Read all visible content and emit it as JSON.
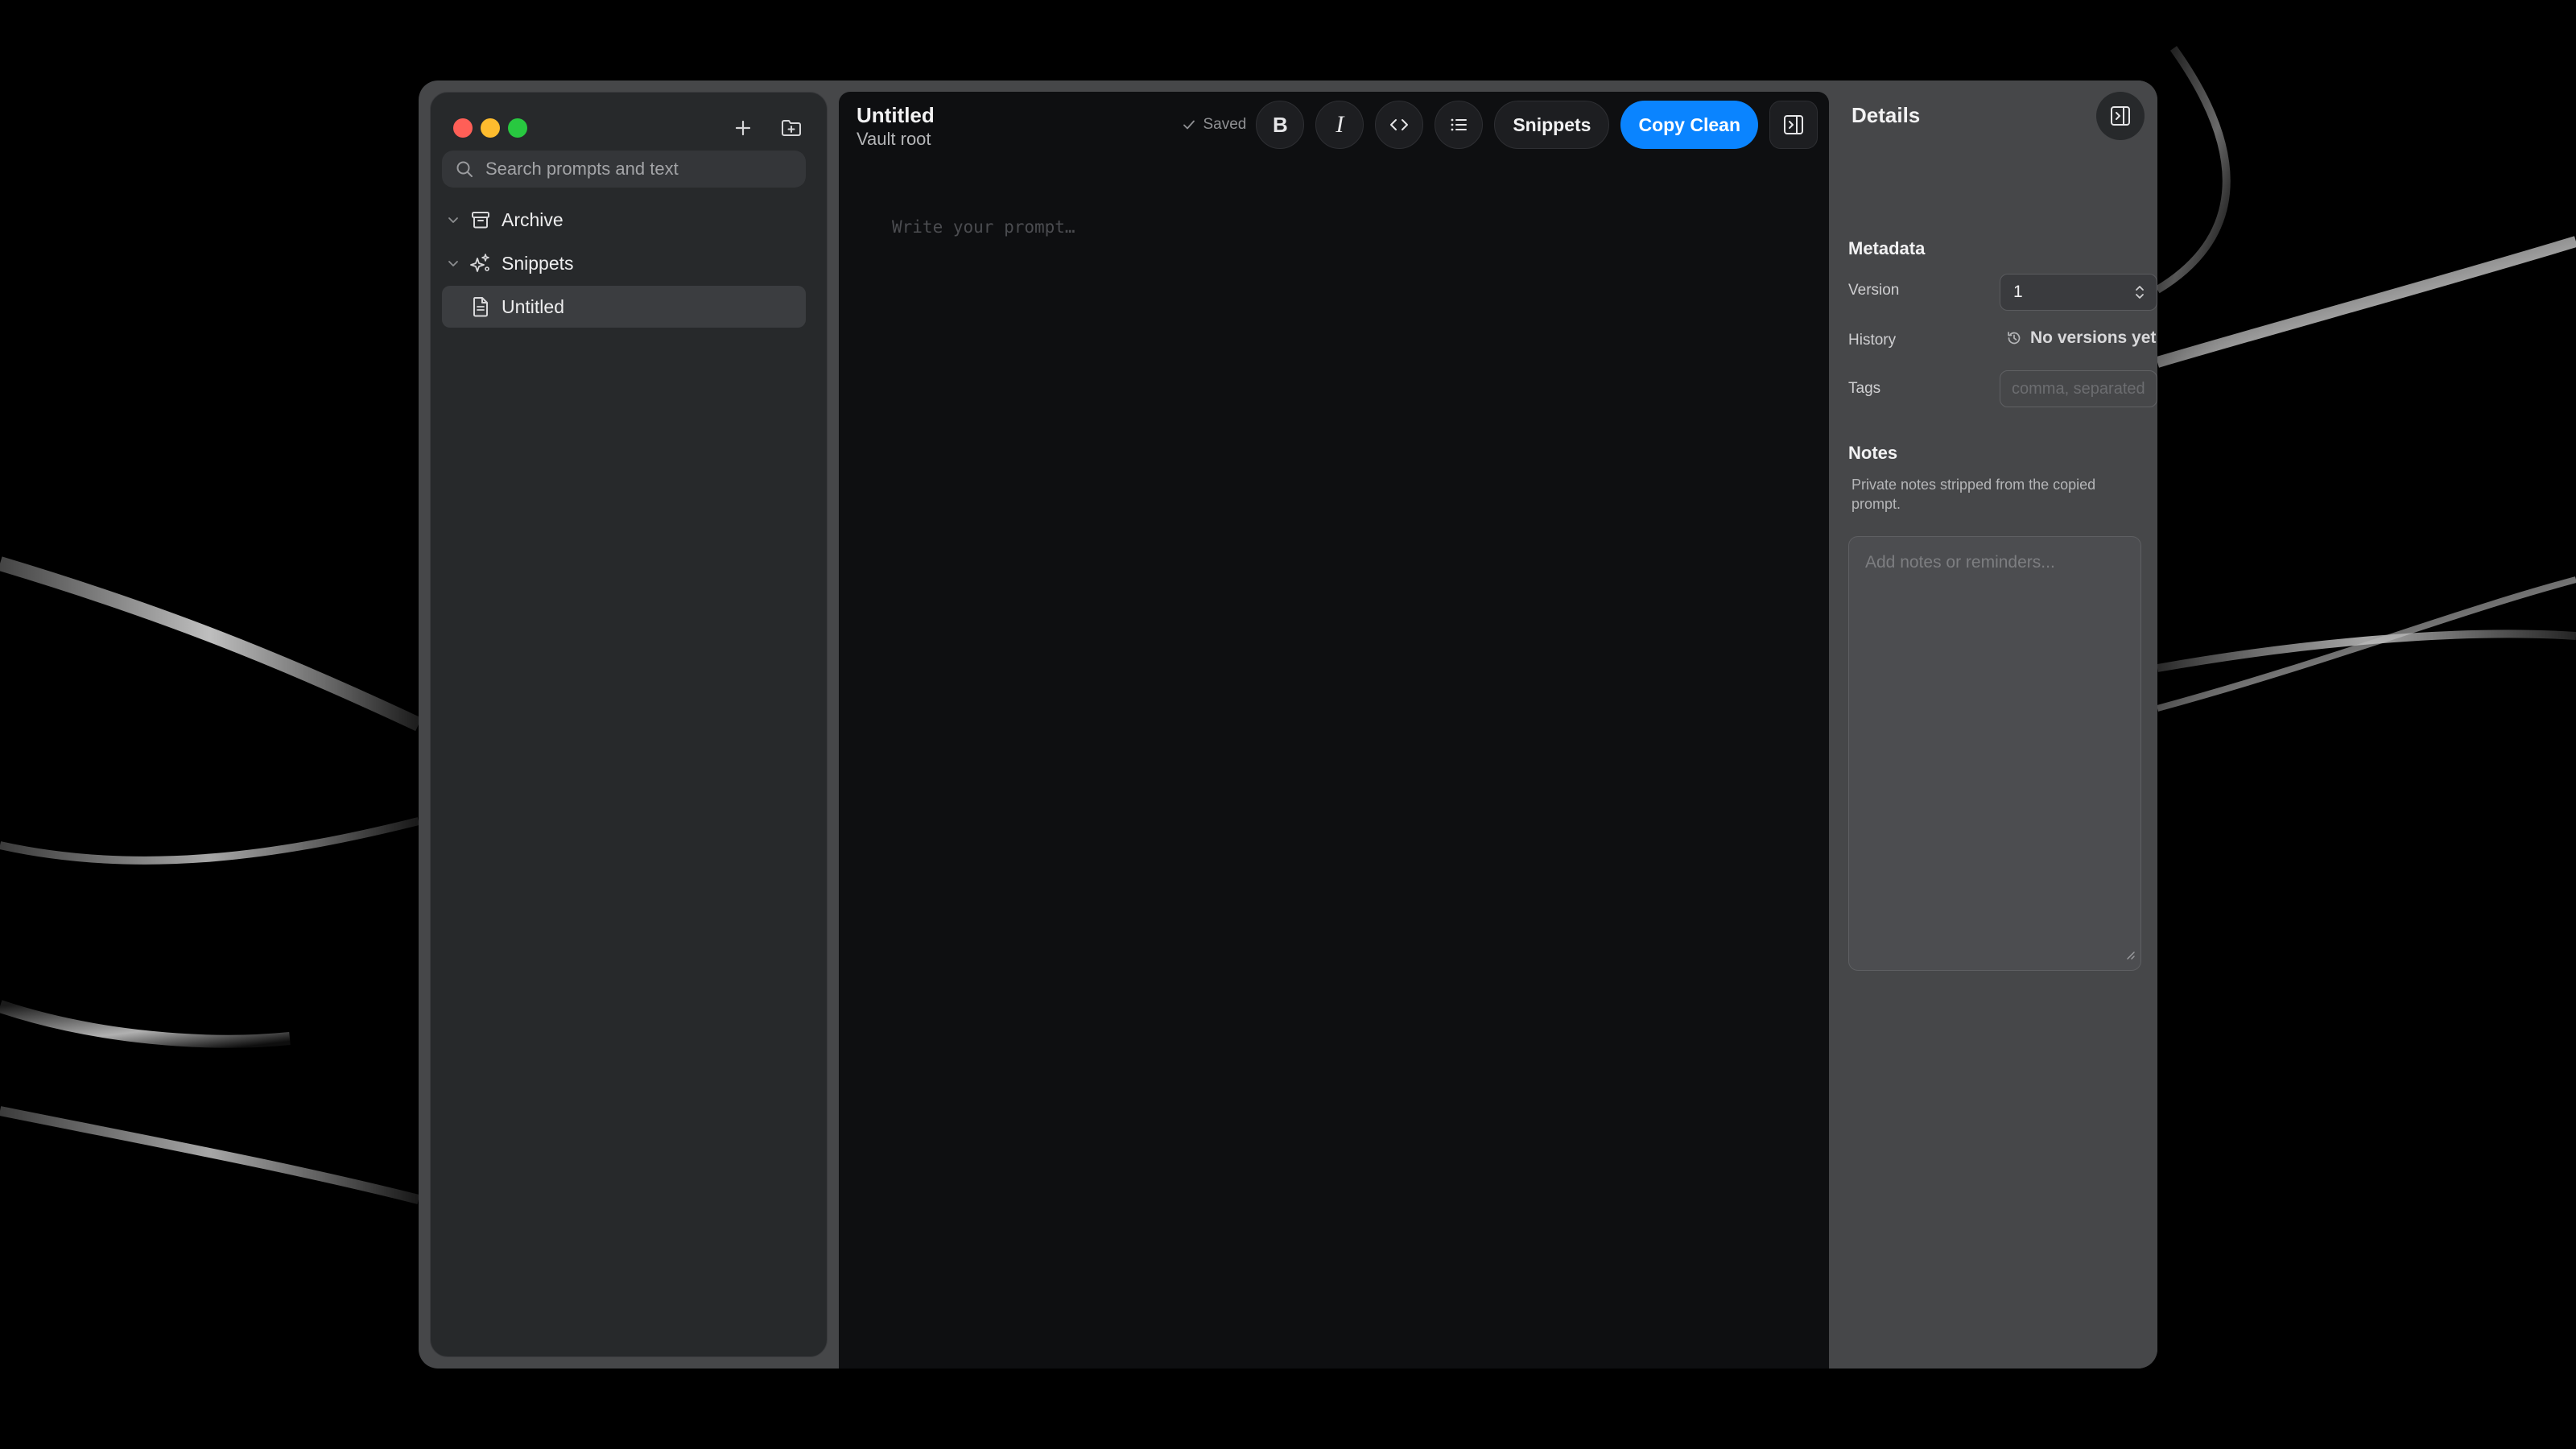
{
  "sidebar": {
    "search_placeholder": "Search prompts and text",
    "items": [
      {
        "label": "Archive",
        "icon": "archive-icon"
      },
      {
        "label": "Snippets",
        "icon": "snippets-icon"
      },
      {
        "label": "Untitled",
        "icon": "document-icon",
        "selected": true
      }
    ]
  },
  "editor": {
    "title": "Untitled",
    "subtitle": "Vault root",
    "saved_label": "Saved",
    "snippets_label": "Snippets",
    "copy_clean_label": "Copy Clean",
    "placeholder": "Write your prompt…"
  },
  "details": {
    "title": "Details",
    "metadata_title": "Metadata",
    "version_label": "Version",
    "version_value": "1",
    "history_label": "History",
    "history_value": "No versions yet",
    "tags_label": "Tags",
    "tags_placeholder": "comma, separated",
    "notes_title": "Notes",
    "notes_description": "Private notes stripped from the copied prompt.",
    "notes_placeholder": "Add notes or reminders..."
  },
  "colors": {
    "accent": "#0a84ff",
    "traffic_red": "#ff5f57",
    "traffic_yellow": "#febc2e",
    "traffic_green": "#28c840"
  }
}
